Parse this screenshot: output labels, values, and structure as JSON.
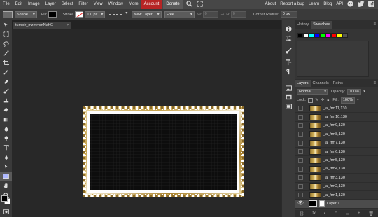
{
  "menubar": {
    "items": [
      "File",
      "Edit",
      "Image",
      "Layer",
      "Select",
      "Filter",
      "View",
      "Window",
      "More"
    ],
    "account": "Account",
    "donate": "Donate",
    "right_items": [
      "About",
      "Report a bug",
      "Learn",
      "Blog",
      "API"
    ],
    "social_icons": [
      "reddit-icon",
      "twitter-icon",
      "facebook-icon"
    ]
  },
  "options": {
    "shape_select": "Shape",
    "fill_label": "Fill:",
    "stroke_label": "Stroke",
    "stroke_width": "1.0 px",
    "layer_mode": "New Layer",
    "constraint": "Free",
    "w_label": "W:",
    "w_value": "0",
    "h_label": "H:",
    "h_value": "0",
    "corner_label": "Corner Radius:",
    "corner_value": "0 px"
  },
  "document": {
    "tab_title": "tumblr_mzmrhmNahG",
    "tab_close": "×"
  },
  "panels": {
    "history_tab": "History",
    "swatches_tab": "Swatches",
    "swatch_colors": [
      "#000000",
      "#ffffff",
      "#00ffff",
      "#0000ff",
      "#00ff00",
      "#ff00ff",
      "#ff0000",
      "#ffff00",
      "#555555"
    ],
    "layers_tab": "Layers",
    "channels_tab": "Channels",
    "paths_tab": "Paths",
    "blend_mode": "Normal",
    "opacity_label": "Opacity:",
    "opacity_value": "100%",
    "lock_label": "Lock:",
    "fill_label": "Fill:",
    "fill_value": "100%"
  },
  "layers": [
    "_a_frm11,130",
    "_a_frm10,130",
    "_a_frm9,130",
    "_a_frm8,130",
    "_a_frm7,130",
    "_a_frm6,130",
    "_a_frm5,130",
    "_a_frm4,130",
    "_a_frm3,130",
    "_a_frm2,130",
    "_a_frm1,130",
    "Layer 1"
  ],
  "colors": {
    "accent_account": "#b62525",
    "foreground": "#000000",
    "background": "#ffffff"
  }
}
